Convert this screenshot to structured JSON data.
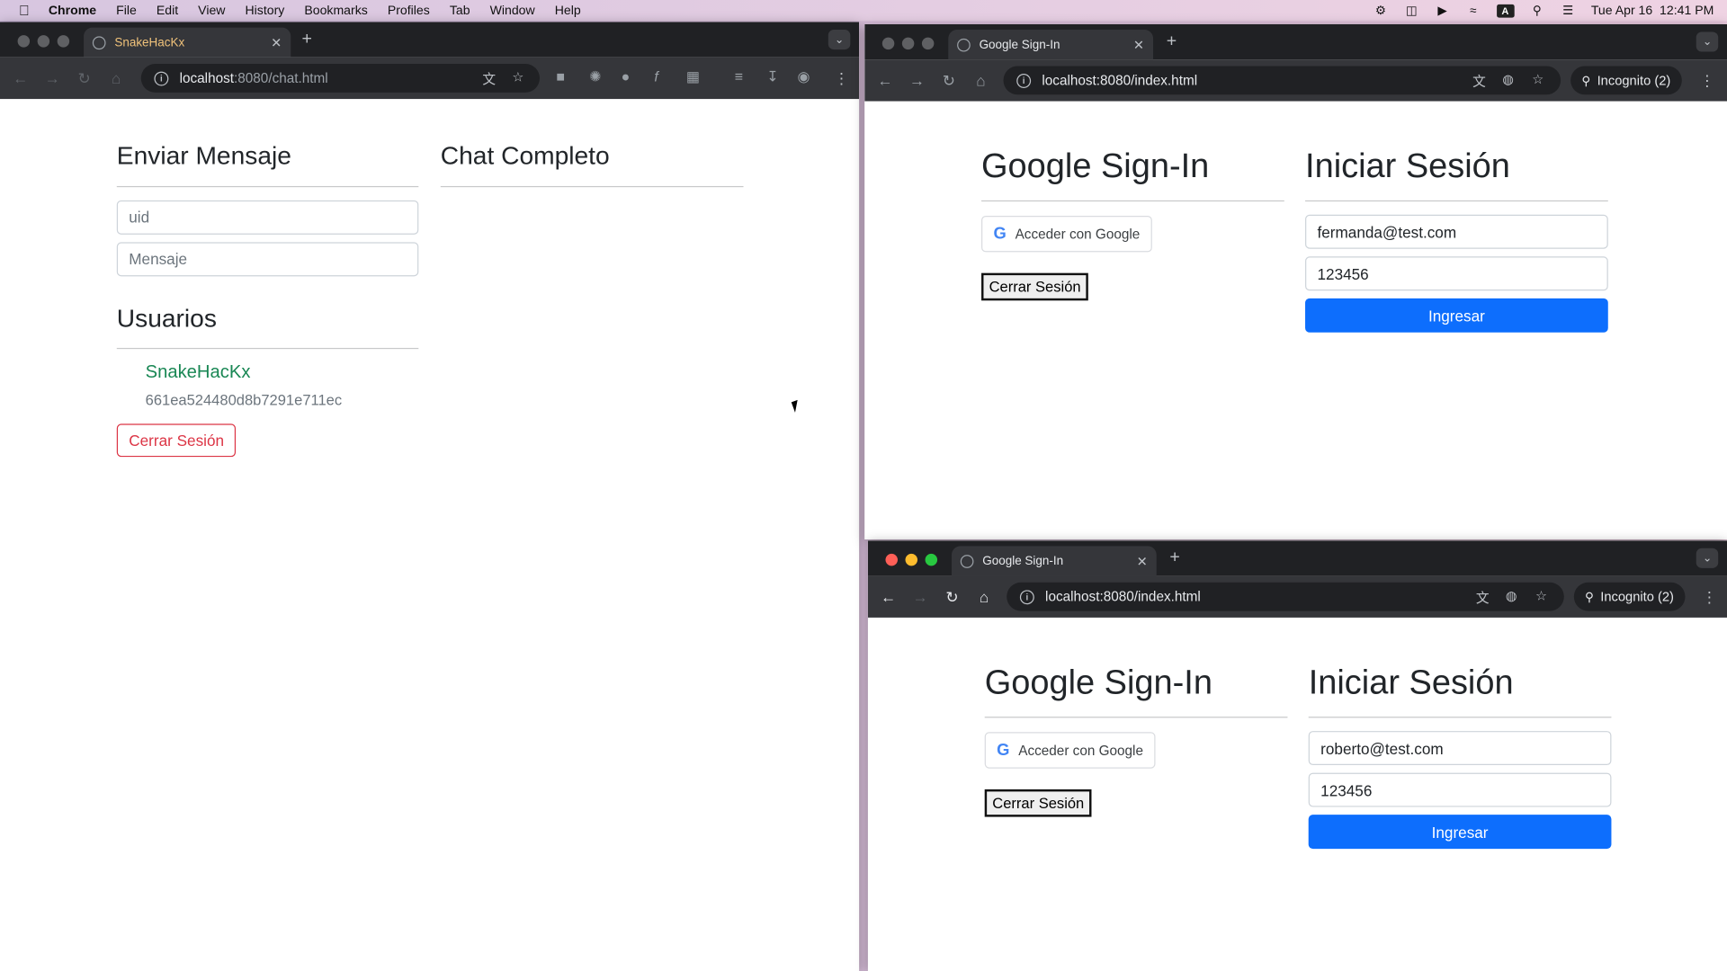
{
  "menubar": {
    "app": "Chrome",
    "items": [
      "File",
      "Edit",
      "View",
      "History",
      "Bookmarks",
      "Profiles",
      "Tab",
      "Window",
      "Help"
    ],
    "datetime": "Tue Apr 16  12:41 PM",
    "input_badge": "A"
  },
  "left_window": {
    "tab_title": "SnakeHacKx",
    "url_host": "localhost",
    "url_path": ":8080/chat.html",
    "send_heading": "Enviar Mensaje",
    "uid_placeholder": "uid",
    "message_placeholder": "Mensaje",
    "users_heading": "Usuarios",
    "user_name": "SnakeHacKx",
    "user_id": "661ea524480d8b7291e711ec",
    "logout_label": "Cerrar Sesión",
    "chat_heading": "Chat Completo",
    "user_color": "#198754"
  },
  "top_right_window": {
    "tab_title": "Google Sign-In",
    "url": "localhost:8080/index.html",
    "incognito": "Incognito (2)",
    "google_heading": "Google Sign-In",
    "google_button": "Acceder con Google",
    "logout_label": "Cerrar Sesión",
    "login_heading": "Iniciar Sesión",
    "email_value": "fermanda@test.com",
    "password_value": "123456",
    "submit_label": "Ingresar"
  },
  "bottom_right_window": {
    "tab_title": "Google Sign-In",
    "url": "localhost:8080/index.html",
    "incognito": "Incognito (2)",
    "google_heading": "Google Sign-In",
    "google_button": "Acceder con Google",
    "logout_label": "Cerrar Sesión",
    "login_heading": "Iniciar Sesión",
    "email_value": "roberto@test.com",
    "password_value": "123456",
    "submit_label": "Ingresar"
  }
}
